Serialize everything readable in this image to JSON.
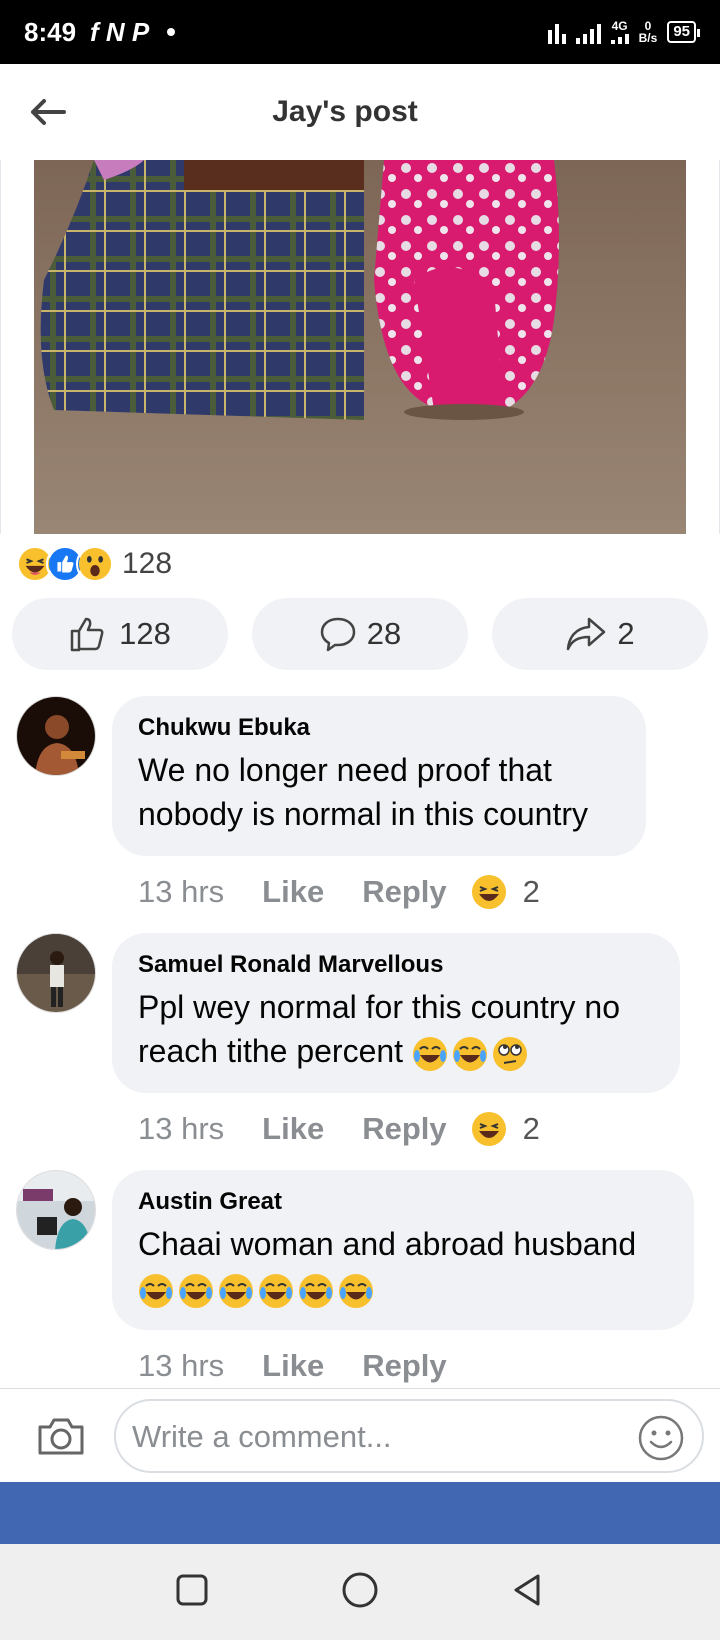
{
  "status_bar": {
    "time": "8:49",
    "app_icons": "f N P",
    "network": "4G",
    "speed_value": "0",
    "speed_unit": "B/s",
    "battery": "95"
  },
  "header": {
    "title": "Jay's post"
  },
  "post": {
    "reactions_total": "128",
    "reaction_icons": [
      "laughing-emoji-icon",
      "like-reaction-icon",
      "wow-emoji-icon"
    ],
    "actions": {
      "like_count": "128",
      "comment_count": "28",
      "share_count": "2"
    }
  },
  "comments": [
    {
      "name": "Chukwu Ebuka",
      "text": "We no longer need proof that nobody is normal in this country",
      "time": "13 hrs",
      "like_label": "Like",
      "reply_label": "Reply",
      "reaction_count": "2"
    },
    {
      "name": "Samuel Ronald Marvellous",
      "text": "Ppl wey normal for this country no reach tithe percent",
      "time": "13 hrs",
      "like_label": "Like",
      "reply_label": "Reply",
      "reaction_count": "2"
    },
    {
      "name": "Austin Great",
      "text": "Chaai woman and abroad husband",
      "time": "13 hrs",
      "like_label": "Like",
      "reply_label": "Reply"
    }
  ],
  "composer": {
    "placeholder": "Write a comment..."
  },
  "colors": {
    "brand_blue": "#4267b2",
    "pill_bg": "#f0f2f5",
    "meta_gray": "#8a8d91"
  }
}
